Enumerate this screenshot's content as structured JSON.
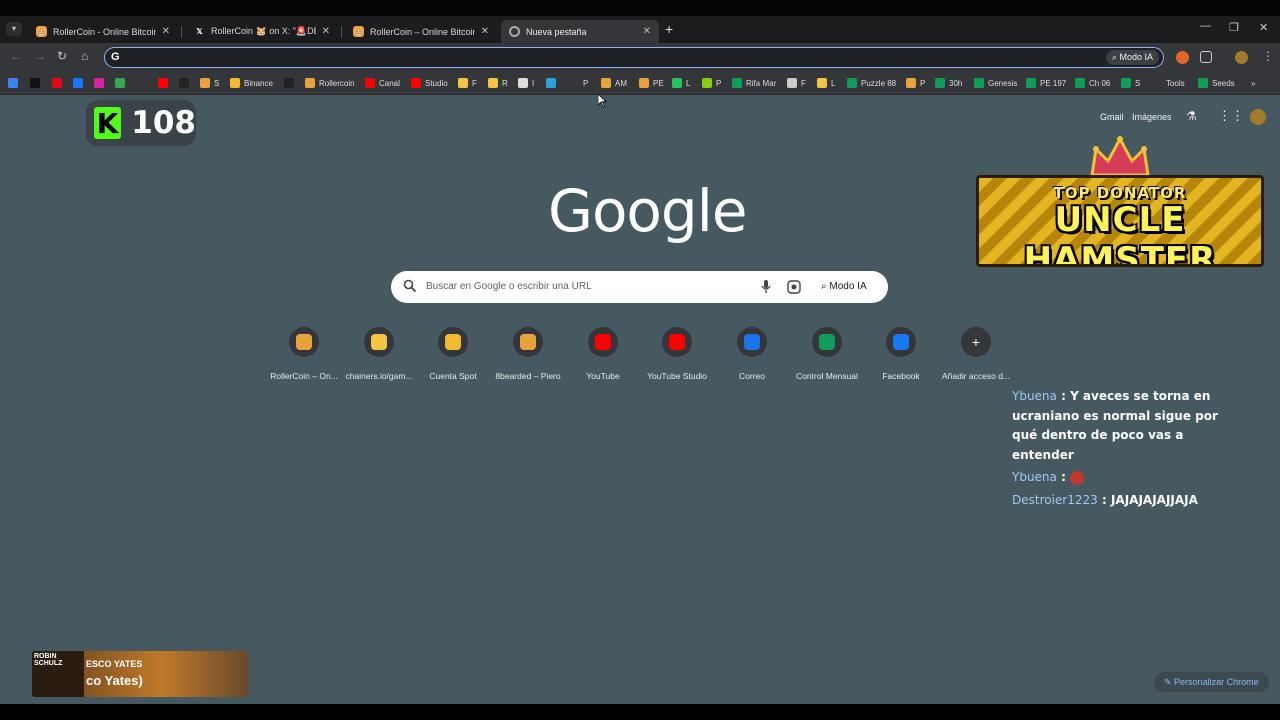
{
  "tabs": [
    {
      "title": "RollerCoin - Online Bitcoin Mining",
      "favicon": "hamster-icon",
      "active": false
    },
    {
      "title": "RollerCoin 🐹 on X: \"🚨DEEP D",
      "favicon": "x-icon",
      "active": false
    },
    {
      "title": "RollerCoin – Online Bitcoin Mining",
      "favicon": "hamster-icon",
      "active": false
    },
    {
      "title": "Nueva pestaña",
      "favicon": "chrome-icon",
      "active": true
    }
  ],
  "omnibox": {
    "value": "",
    "ai_mode_label": "Modo IA"
  },
  "bookmarks": [
    {
      "label": "",
      "icon": "generic-icon",
      "color": "#3b82f6"
    },
    {
      "label": "",
      "icon": "tiktok-icon",
      "color": "#111111"
    },
    {
      "label": "",
      "icon": "netflix-icon",
      "color": "#e50914"
    },
    {
      "label": "",
      "icon": "facebook-icon",
      "color": "#1877f2"
    },
    {
      "label": "",
      "icon": "instagram-icon",
      "color": "#d6249f"
    },
    {
      "label": "",
      "icon": "drive-icon",
      "color": "#34a853"
    },
    {
      "label": "",
      "icon": "youtube-icon",
      "color": "#ff0000"
    },
    {
      "label": "",
      "icon": "x-icon",
      "color": "#222222"
    },
    {
      "label": "S",
      "icon": "hamster-icon",
      "color": "#e9a23b"
    },
    {
      "label": "Binance",
      "icon": "binance-icon",
      "color": "#f3ba2f"
    },
    {
      "label": "",
      "icon": "tv-icon",
      "color": "#222222"
    },
    {
      "label": "Rollercoin",
      "icon": "hamster-icon",
      "color": "#e9a23b"
    },
    {
      "label": "Canal",
      "icon": "youtube-icon",
      "color": "#ff0000"
    },
    {
      "label": "Studio",
      "icon": "youtube-icon",
      "color": "#ff0000"
    },
    {
      "label": "F",
      "icon": "dice-icon",
      "color": "#f4c542"
    },
    {
      "label": "R",
      "icon": "dice-icon",
      "color": "#f4c542"
    },
    {
      "label": "I",
      "icon": "clock-icon",
      "color": "#dddddd"
    },
    {
      "label": "",
      "icon": "telegram-icon",
      "color": "#2aa1da"
    },
    {
      "label": "P",
      "icon": "folder-icon",
      "color": "#35363a"
    },
    {
      "label": "AM",
      "icon": "pickaxe-icon",
      "color": "#e9a23b"
    },
    {
      "label": "PE",
      "icon": "pickaxe-icon",
      "color": "#e9a23b"
    },
    {
      "label": "L",
      "icon": "l-icon",
      "color": "#22c55e"
    },
    {
      "label": "P",
      "icon": "p-icon",
      "color": "#84cc16"
    },
    {
      "label": "Rifa Mar",
      "icon": "sheets-icon",
      "color": "#0f9d58"
    },
    {
      "label": "F",
      "icon": "gear-icon",
      "color": "#cccccc"
    },
    {
      "label": "L",
      "icon": "dice-icon",
      "color": "#f4c542"
    },
    {
      "label": "Puzzle 88",
      "icon": "sheets-icon",
      "color": "#0f9d58"
    },
    {
      "label": "P",
      "icon": "hamster-icon",
      "color": "#e9a23b"
    },
    {
      "label": "30h",
      "icon": "sheets-icon",
      "color": "#0f9d58"
    },
    {
      "label": "Genesis",
      "icon": "sheets-icon",
      "color": "#0f9d58"
    },
    {
      "label": "PE 197",
      "icon": "sheets-icon",
      "color": "#0f9d58"
    },
    {
      "label": "Ch 06",
      "icon": "sheets-icon",
      "color": "#0f9d58"
    },
    {
      "label": "S",
      "icon": "sheets-icon",
      "color": "#0f9d58"
    },
    {
      "label": "Tools",
      "icon": "folder-icon",
      "color": "#35363a"
    },
    {
      "label": "Seeds",
      "icon": "sheets-icon",
      "color": "#0f9d58"
    }
  ],
  "kick": {
    "count": "108"
  },
  "google_links": {
    "gmail": "Gmail",
    "images": "Imágenes"
  },
  "logo_text": "Google",
  "search": {
    "placeholder": "Buscar en Google o escribir una URL",
    "ai_mode_label": "Modo IA"
  },
  "shortcuts": [
    {
      "label": "RollerCoin – On...",
      "icon": "hamster-icon",
      "color": "#e9a23b"
    },
    {
      "label": "chainers.io/gam...",
      "icon": "dice-icon",
      "color": "#f4c542"
    },
    {
      "label": "Cuenta Spot",
      "icon": "binance-icon",
      "color": "#f3ba2f"
    },
    {
      "label": "8bearded – Piero",
      "icon": "pickaxe-icon",
      "color": "#e9a23b"
    },
    {
      "label": "YouTube",
      "icon": "youtube-icon",
      "color": "#ff0000"
    },
    {
      "label": "YouTube Studio",
      "icon": "youtube-icon",
      "color": "#ff0000"
    },
    {
      "label": "Correo",
      "icon": "mail-icon",
      "color": "#1a73e8"
    },
    {
      "label": "Control Mensual",
      "icon": "sheets-icon",
      "color": "#0f9d58"
    },
    {
      "label": "Facebook",
      "icon": "facebook-icon",
      "color": "#1877f2"
    },
    {
      "label": "Añadir acceso d...",
      "icon": "plus-icon",
      "color": "#35363a"
    }
  ],
  "donator": {
    "line1": "TOP DONATOR",
    "line2": "UNCLE HAMSTER"
  },
  "chat": [
    {
      "user": "Ybuena",
      "sep": " : ",
      "text": "Y aveces se torna en ucraniano es normal sigue por qué dentro de poco vas a entender"
    },
    {
      "user": "Ybuena",
      "sep": " : ",
      "text": ""
    },
    {
      "user": "Destroier1223",
      "sep": " : ",
      "text": "JAJAJAJAJJAJA"
    }
  ],
  "music": {
    "artist_art": "ROBIN SCHULZ",
    "line1": "ESCO YATES",
    "line2": "co Yates)"
  },
  "customize_label": "Personalizar Chrome"
}
